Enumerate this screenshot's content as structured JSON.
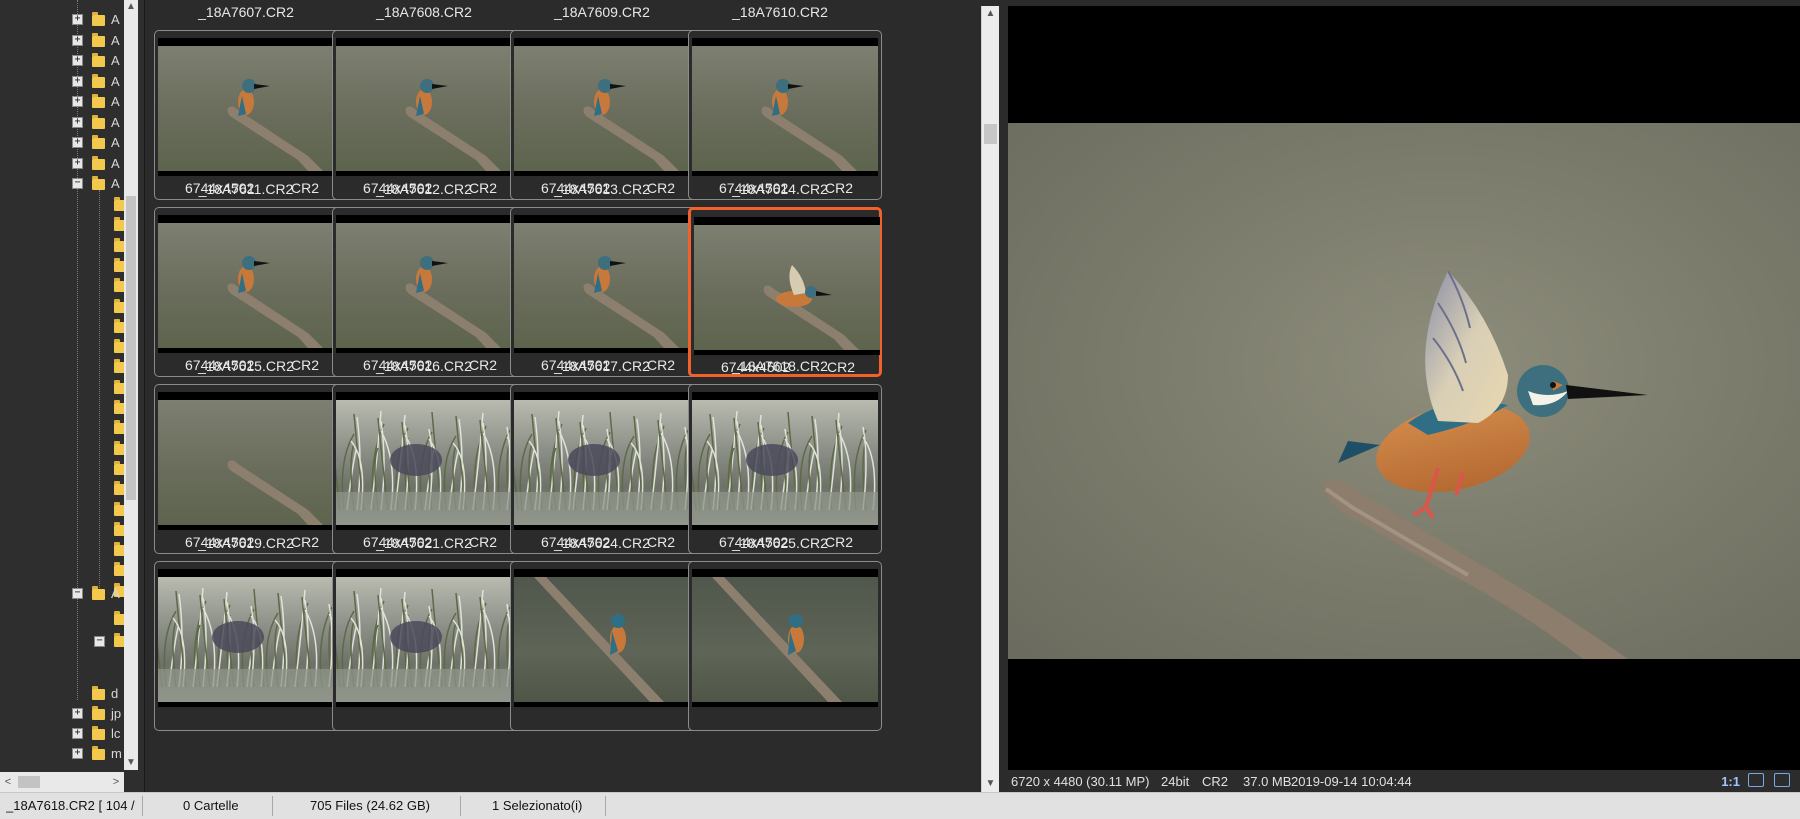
{
  "tree": {
    "items": [
      {
        "label": "A",
        "expander": "+"
      },
      {
        "label": "A",
        "expander": "+"
      },
      {
        "label": "A",
        "expander": "+"
      },
      {
        "label": "A",
        "expander": "+"
      },
      {
        "label": "A",
        "expander": "+"
      },
      {
        "label": "A",
        "expander": "+"
      },
      {
        "label": "A",
        "expander": "+"
      },
      {
        "label": "A",
        "expander": "+"
      },
      {
        "label": "A",
        "expander": "−"
      }
    ],
    "lower_items": [
      {
        "label": "A",
        "expander": "−"
      },
      {
        "label": "d",
        "expander": ""
      },
      {
        "label": "jp",
        "expander": "+"
      },
      {
        "label": "lc",
        "expander": "+"
      },
      {
        "label": "m",
        "expander": "+"
      }
    ]
  },
  "thumbnails": [
    {
      "name": "_18A7607.CR2",
      "dimensions": "6744x4502",
      "format": "CR2",
      "scene": "kf"
    },
    {
      "name": "_18A7608.CR2",
      "dimensions": "6744x4502",
      "format": "CR2",
      "scene": "kf"
    },
    {
      "name": "_18A7609.CR2",
      "dimensions": "6744x4502",
      "format": "CR2",
      "scene": "kf"
    },
    {
      "name": "_18A7610.CR2",
      "dimensions": "6744x4502",
      "format": "CR2",
      "scene": "kf"
    },
    {
      "name": "_18A7611.CR2",
      "dimensions": "6744x4502",
      "format": "CR2",
      "scene": "kf"
    },
    {
      "name": "_18A7612.CR2",
      "dimensions": "6744x4502",
      "format": "CR2",
      "scene": "kf"
    },
    {
      "name": "_18A7613.CR2",
      "dimensions": "6744x4502",
      "format": "CR2",
      "scene": "kf"
    },
    {
      "name": "_18A7614.CR2",
      "dimensions": "6744x4502",
      "format": "CR2",
      "scene": "kf-fly",
      "selected": true
    },
    {
      "name": "_18A7615.CR2",
      "dimensions": "6744x4502",
      "format": "CR2",
      "scene": "branch"
    },
    {
      "name": "_18A7616.CR2",
      "dimensions": "6744x4502",
      "format": "CR2",
      "scene": "grass"
    },
    {
      "name": "_18A7617.CR2",
      "dimensions": "6744x4502",
      "format": "CR2",
      "scene": "grass"
    },
    {
      "name": "_18A7618.CR2",
      "dimensions": "6744x4502",
      "format": "CR2",
      "scene": "grass"
    },
    {
      "name": "_18A7619.CR2",
      "dimensions": "",
      "format": "",
      "scene": "grass"
    },
    {
      "name": "_18A7621.CR2",
      "dimensions": "",
      "format": "",
      "scene": "grass"
    },
    {
      "name": "_18A7624.CR2",
      "dimensions": "",
      "format": "",
      "scene": "kf-diag"
    },
    {
      "name": "_18A7625.CR2",
      "dimensions": "",
      "format": "",
      "scene": "kf-diag"
    }
  ],
  "preview_info": {
    "dimensions": "6720 x 4480 (30.11 MP)",
    "bitdepth": "24bit",
    "format": "CR2",
    "size": "37.0 MB",
    "datetime": "2019-09-14 10:04:44",
    "zoom": "1:1"
  },
  "status": {
    "current": "_18A7618.CR2 [ 104 /",
    "folders": "0 Cartelle",
    "files": "705 Files (24.62 GB)",
    "selected": "1 Selezionato(i)"
  },
  "colors": {
    "selection": "#f0612c",
    "folder": "#f2c94c"
  }
}
